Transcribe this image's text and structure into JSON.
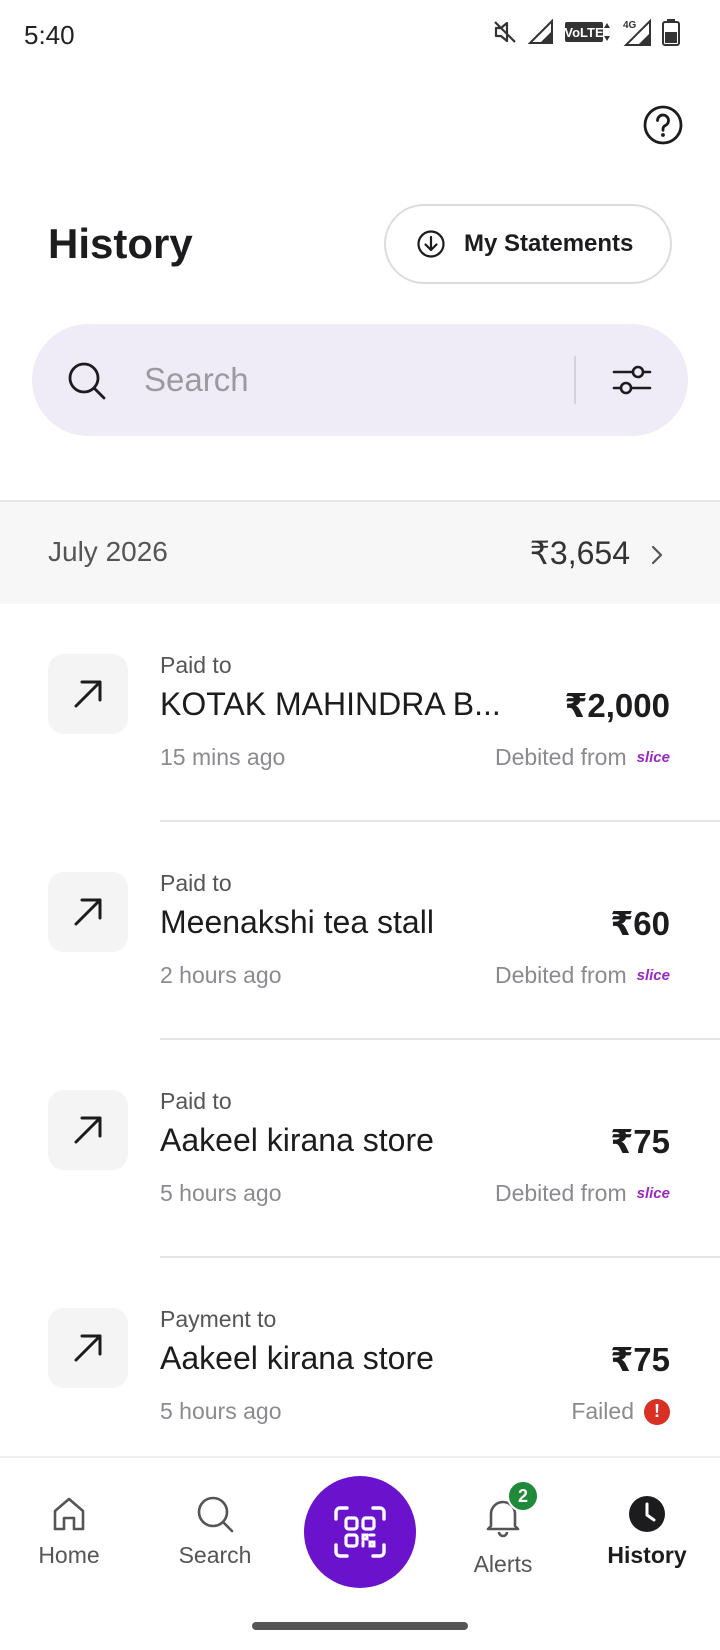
{
  "status_bar": {
    "time": "5:40",
    "icons": [
      "mute-icon",
      "signal-icon",
      "volte-icon",
      "4g-signal-icon",
      "battery-icon"
    ],
    "volte_label": "VoLTE",
    "network_label": "4G"
  },
  "header": {
    "title": "History",
    "statements_label": "My Statements",
    "help_icon": "help-icon"
  },
  "search": {
    "placeholder": "Search",
    "value": ""
  },
  "month": {
    "label": "July 2026",
    "total": "₹3,654"
  },
  "transactions": [
    {
      "type": "Paid to",
      "name": "KOTAK MAHINDRA B...",
      "amount": "₹2,000",
      "time": "15 mins ago",
      "status": "Debited from",
      "source": "slice"
    },
    {
      "type": "Paid to",
      "name": "Meenakshi tea stall",
      "amount": "₹60",
      "time": "2 hours ago",
      "status": "Debited from",
      "source": "slice"
    },
    {
      "type": "Paid to",
      "name": "Aakeel kirana store",
      "amount": "₹75",
      "time": "5 hours ago",
      "status": "Debited from",
      "source": "slice"
    },
    {
      "type": "Payment to",
      "name": "Aakeel kirana store",
      "amount": "₹75",
      "time": "5 hours ago",
      "status": "Failed",
      "failed_mark": "!"
    }
  ],
  "nav": {
    "home": "Home",
    "search": "Search",
    "alerts": "Alerts",
    "alerts_badge": "2",
    "history": "History"
  },
  "colors": {
    "accent": "#6a12cc",
    "search_bg": "#efecf8",
    "brand": "#9b27c7",
    "failed": "#d93025",
    "badge": "#1e8a3a"
  }
}
